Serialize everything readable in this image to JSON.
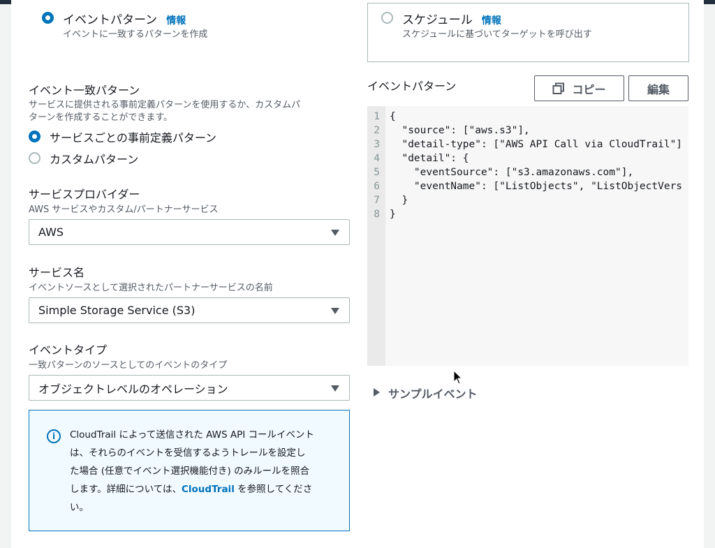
{
  "event_pattern_option": {
    "title": "イベントパターン",
    "info": "情報",
    "description": "イベントに一致するパターンを作成"
  },
  "schedule_option": {
    "title": "スケジュール",
    "info": "情報",
    "description": "スケジュールに基づいてターゲットを呼び出す"
  },
  "matching": {
    "heading": "イベント一致パターン",
    "desc_line1": "サービスに提供される事前定義パターンを使用するか、カスタムパ",
    "desc_line2": "ターンを作成することができます。",
    "option_predefined": "サービスごとの事前定義パターン",
    "option_custom": "カスタムパターン"
  },
  "provider": {
    "label": "サービスプロバイダー",
    "description": "AWS サービスやカスタム/パートナーサービス",
    "value": "AWS"
  },
  "service_name": {
    "label": "サービス名",
    "description": "イベントソースとして選択されたパートナーサービスの名前",
    "value": "Simple Storage Service (S3)"
  },
  "event_type": {
    "label": "イベントタイプ",
    "description": "一致パターンのソースとしてのイベントのタイプ",
    "value": "オブジェクトレベルのオペレーション"
  },
  "info_alert": {
    "line1_pre": "CloudTrail",
    "line1_post": " によって送信された AWS API コールイベント",
    "line2": "は、それらのイベントを受信するようトレールを設定し",
    "line3": "た場合 (任意でイベント選択機能付き) のみルールを照合",
    "line4_pre": "します。詳細については、",
    "line4_link": "CloudTrail",
    "line4_post": " を参照してくださ",
    "line5": "い。"
  },
  "pattern_panel": {
    "heading": "イベントパターン",
    "copy_label": "コピー",
    "edit_label": "編集",
    "lines": [
      {
        "n": "1",
        "text": "{"
      },
      {
        "n": "2",
        "text": "  \"source\": [\"aws.s3\"],"
      },
      {
        "n": "3",
        "text": "  \"detail-type\": [\"AWS API Call via CloudTrail\"]"
      },
      {
        "n": "4",
        "text": "  \"detail\": {"
      },
      {
        "n": "5",
        "text": "    \"eventSource\": [\"s3.amazonaws.com\"],"
      },
      {
        "n": "6",
        "text": "    \"eventName\": [\"ListObjects\", \"ListObjectVers"
      },
      {
        "n": "7",
        "text": "  }"
      },
      {
        "n": "8",
        "text": "}"
      }
    ]
  },
  "sample_event": {
    "label": "サンプルイベント"
  }
}
